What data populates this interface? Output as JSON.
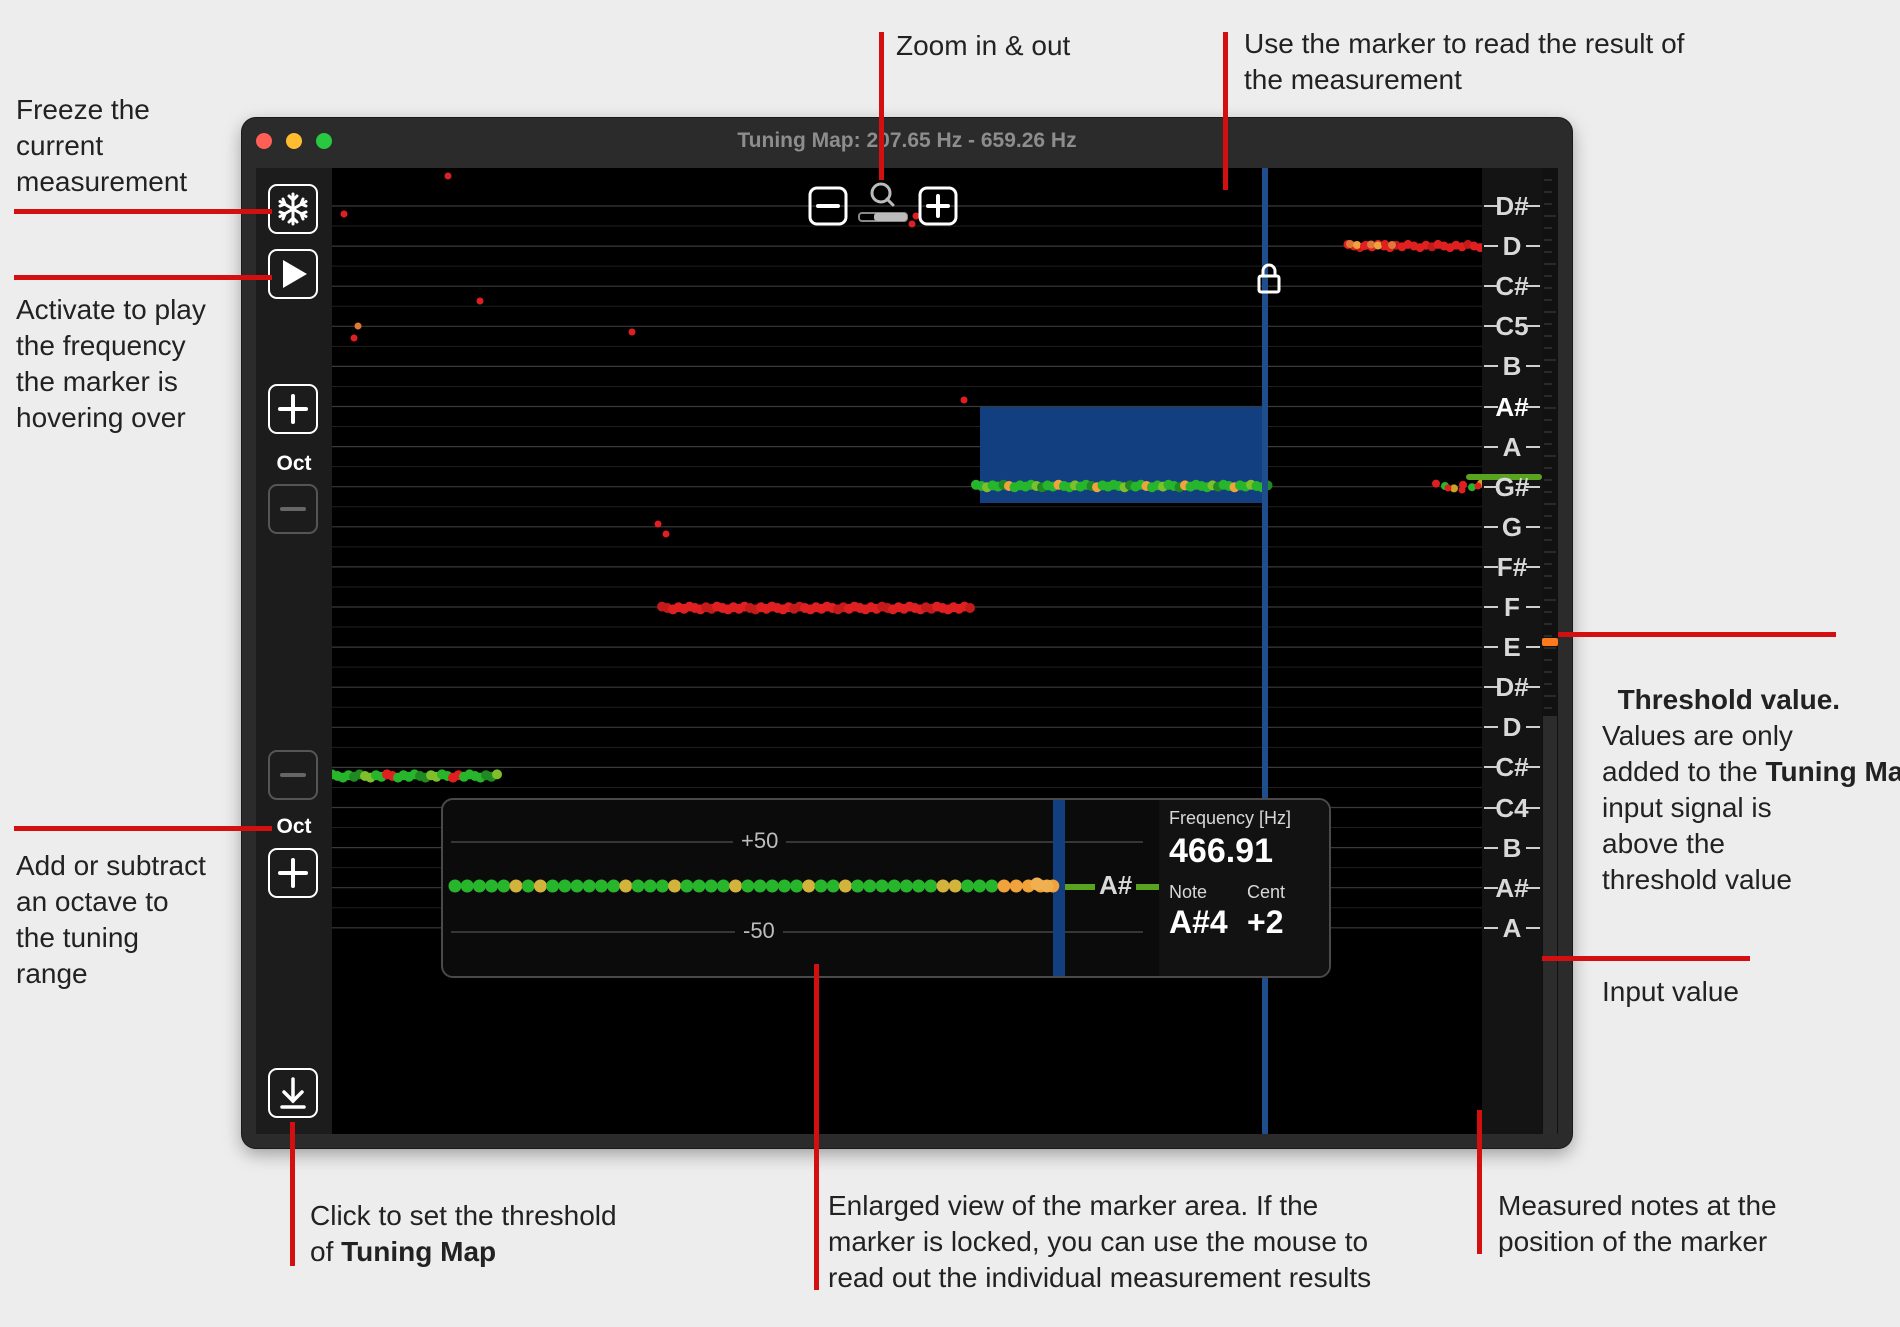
{
  "window": {
    "title": "Tuning Map: 207.65  Hz - 659.26  Hz",
    "traffic_lights": {
      "close": "#ff5f57",
      "minimize": "#febc2e",
      "zoom": "#28c840"
    }
  },
  "left_panel": {
    "freeze_icon": "snowflake-icon",
    "play_icon": "play-icon",
    "oct_top_label": "Oct",
    "oct_bottom_label": "Oct",
    "threshold_icon": "download-arrow-icon"
  },
  "note_scale": [
    "D#",
    "D",
    "C#",
    "C5",
    "B",
    "A#",
    "A",
    "G#",
    "G",
    "F#",
    "F",
    "E",
    "D#",
    "D",
    "C#",
    "C4",
    "B",
    "A#",
    "A"
  ],
  "highlighted_note": "A#",
  "enlarged_view": {
    "plus_label": "+50",
    "minus_label": "-50",
    "note_tag": "A#",
    "frequency_label": "Frequency [Hz]",
    "frequency_value": "466.91",
    "note_label": "Note",
    "note_value": "A#4",
    "cent_label": "Cent",
    "cent_value": "+2"
  },
  "colors": {
    "annotation_line": "#d30f0f",
    "marker": "#1e4f8c",
    "marker_band": "#123f80",
    "in_tune": "#27b52c",
    "out_of_tune": "#e02020",
    "warning": "#f0a33a",
    "threshold": "#ff7a1a"
  },
  "annotations": {
    "freeze": "Freeze the\ncurrent\nmeasurement",
    "play": "Activate to play\nthe frequency\nthe marker is\nhovering over",
    "octave": "Add or subtract\nan octave to\nthe tuning\nrange",
    "zoom": "Zoom in & out",
    "marker": "Use the marker to read the result of\nthe measurement",
    "threshold_title": "Threshold value.",
    "threshold_pre": "Values are only\nadded to the",
    "threshold_bold": "Tuning Map",
    "threshold_post": " if the\ninput signal is\nabove the\nthreshold value",
    "input_value": "Input value",
    "click_threshold_pre": "Click to set the threshold\nof ",
    "click_threshold_bold": "Tuning Map",
    "enlarged": "Enlarged view of the marker area. If the\nmarker is locked, you can use the mouse to\nread out the individual measurement results",
    "measured_notes": "Measured notes at the\nposition of the marker"
  }
}
